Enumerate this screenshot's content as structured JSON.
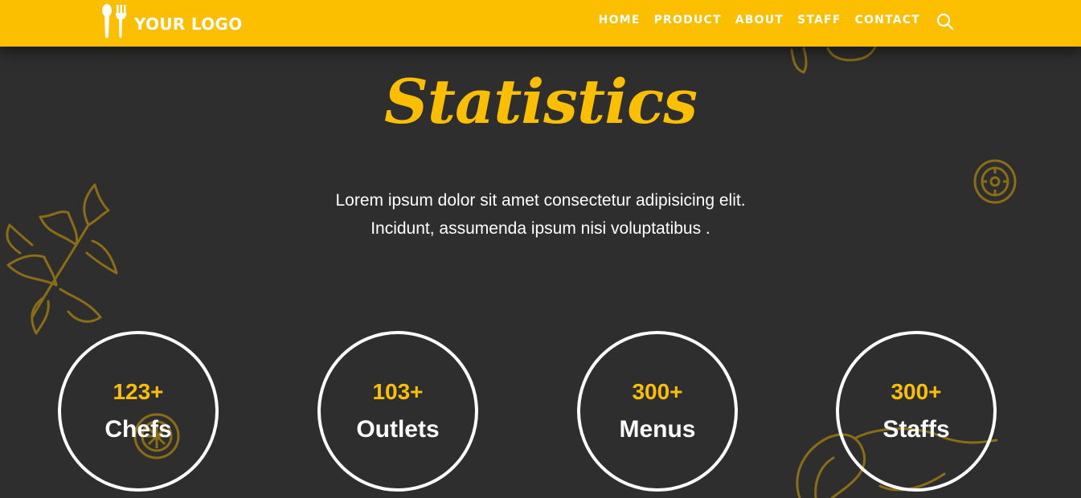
{
  "header": {
    "logo_text": "YOUR LOGO",
    "logo_icon": "spoon-fork-icon",
    "nav": [
      "HOME",
      "PRODUCT",
      "ABOUT",
      "STAFF",
      "CONTACT"
    ],
    "search_icon": "search-icon"
  },
  "section": {
    "title": "Statistics",
    "intro_line1": "Lorem ipsum dolor sit amet consectetur adipisicing elit.",
    "intro_line2": "Incidunt, assumenda ipsum nisi voluptatibus ."
  },
  "stats": [
    {
      "value": "123+",
      "label": "Chefs"
    },
    {
      "value": "103+",
      "label": "Outlets"
    },
    {
      "value": "300+",
      "label": "Menus"
    },
    {
      "value": "300+",
      "label": "Staffs"
    }
  ],
  "colors": {
    "accent": "#fbbf00",
    "background": "#2e2e2e",
    "text": "#ffffff",
    "decoration": "#8a6d14"
  }
}
